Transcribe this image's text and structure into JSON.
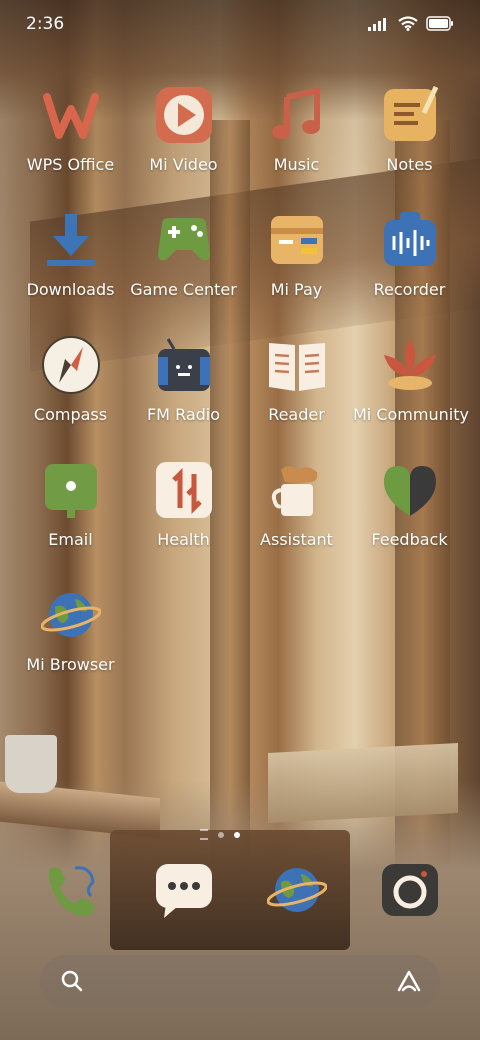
{
  "status_bar": {
    "time": "2:36"
  },
  "apps": [
    {
      "label": "WPS Office",
      "icon": "wps-office-icon"
    },
    {
      "label": "Mi Video",
      "icon": "play-icon"
    },
    {
      "label": "Music",
      "icon": "music-note-icon"
    },
    {
      "label": "Notes",
      "icon": "notepad-pencil-icon"
    },
    {
      "label": "Downloads",
      "icon": "download-arrow-icon"
    },
    {
      "label": "Game Center",
      "icon": "gamepad-icon"
    },
    {
      "label": "Mi Pay",
      "icon": "wallet-icon"
    },
    {
      "label": "Recorder",
      "icon": "recorder-icon"
    },
    {
      "label": "Compass",
      "icon": "compass-icon"
    },
    {
      "label": "FM Radio",
      "icon": "radio-icon"
    },
    {
      "label": "Reader",
      "icon": "open-book-icon"
    },
    {
      "label": "Mi Community",
      "icon": "lotus-icon"
    },
    {
      "label": "Email",
      "icon": "mailbox-icon"
    },
    {
      "label": "Health",
      "icon": "health-icon"
    },
    {
      "label": "Assistant",
      "icon": "coffee-cup-icon"
    },
    {
      "label": "Feedback",
      "icon": "heart-icon"
    },
    {
      "label": "Mi Browser",
      "icon": "planet-icon"
    }
  ],
  "dock": [
    {
      "icon": "phone-icon"
    },
    {
      "icon": "chat-bubble-icon"
    },
    {
      "icon": "planet-icon"
    },
    {
      "icon": "camera-icon"
    }
  ],
  "page_indicator": {
    "pages": 2,
    "active": 2
  },
  "search_bar": {
    "left_icon": "search-icon",
    "right_icon": "assistant-a-icon"
  }
}
